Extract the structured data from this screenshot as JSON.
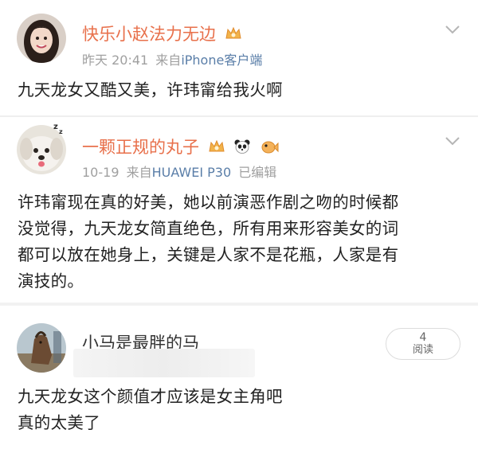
{
  "posts": [
    {
      "username": "快乐小赵法力无边",
      "time": "昨天 20:41",
      "source_prefix": "来自",
      "device": "iPhone客户端",
      "content_lines": [
        "九天龙女又酷又美，许玮甯给我火啊"
      ],
      "avatar": "girl-avatar",
      "badges": [
        "crown-badge"
      ]
    },
    {
      "username": "一颗正规的丸子",
      "time": "10-19",
      "source_prefix": "来自",
      "device": "HUAWEI P30",
      "edited": "已编辑",
      "content_lines": [
        "许玮甯现在真的好美，她以前演恶作剧之吻的时候都",
        "没觉得，九天龙女简直绝色，所有用来形容美女的词",
        "都可以放在她身上，关键是人家不是花瓶，人家是有",
        "演技的。"
      ],
      "avatar": "dog-avatar",
      "badges": [
        "crown-badge",
        "panda-badge",
        "pufferfish-badge"
      ]
    },
    {
      "username": "小马是最胖的马",
      "read_count": "4",
      "read_label": "阅读",
      "content_lines": [
        "九天龙女这个颜值才应该是女主角吧",
        "真的太美了"
      ],
      "avatar": "horse-avatar"
    }
  ],
  "colors": {
    "username": "#e8704b",
    "device": "#5a7ea8",
    "meta": "#a0a0a0",
    "text": "#222222"
  }
}
